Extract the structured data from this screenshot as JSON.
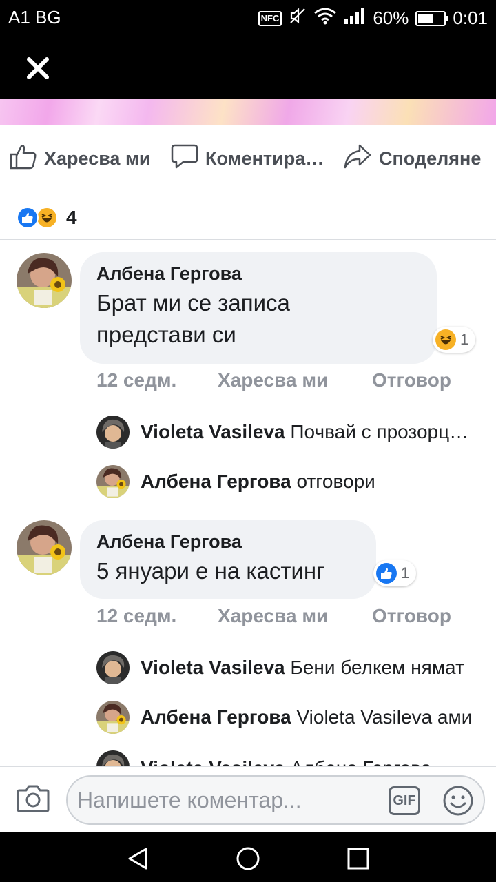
{
  "status_bar": {
    "carrier": "A1 BG",
    "nfc_label": "NFC",
    "battery_percent": "60%",
    "battery_level": 0.6,
    "time": "0:01",
    "icons": [
      "nfc-icon",
      "mute-icon",
      "wifi-icon",
      "signal-icon",
      "battery-icon"
    ]
  },
  "header": {
    "close_icon": "close-icon"
  },
  "post_actions": {
    "like_label": "Харесва ми",
    "comment_label": "Коментира…",
    "share_label": "Споделяне"
  },
  "reactions": {
    "types": [
      "like",
      "haha"
    ],
    "count": "4"
  },
  "comments": [
    {
      "author": "Албена Гергова",
      "text_lines": [
        "Брат ми се записа",
        "представи си"
      ],
      "reaction": {
        "type": "haha",
        "count": "1"
      },
      "time": "12 седм.",
      "like_label": "Харесва ми",
      "reply_label": "Отговор",
      "replies": [
        {
          "author": "Violeta Vasileva",
          "text": "Почвай с прозорците"
        },
        {
          "author": "Албена Гергова",
          "text": "отговори"
        }
      ]
    },
    {
      "author": "Албена Гергова",
      "text_lines": [
        "5 януари е на кастинг"
      ],
      "reaction": {
        "type": "like",
        "count": "1"
      },
      "time": "12 седм.",
      "like_label": "Харесва ми",
      "reply_label": "Отговор",
      "replies": [
        {
          "author": "Violeta Vasileva",
          "text": "Бени белкем нямат"
        },
        {
          "author": "Албена Гергова",
          "text": "Violeta Vasileva ами"
        },
        {
          "author": "Violeta Vasileva",
          "text": "Албена Гергова"
        }
      ]
    }
  ],
  "composer": {
    "placeholder": "Напишете коментар...",
    "gif_label": "GIF"
  },
  "colors": {
    "facebook_blue": "#1877f2",
    "haha_yellow": "#f7b125",
    "text_gray": "#4b4f56",
    "meta_gray": "#90949c"
  }
}
